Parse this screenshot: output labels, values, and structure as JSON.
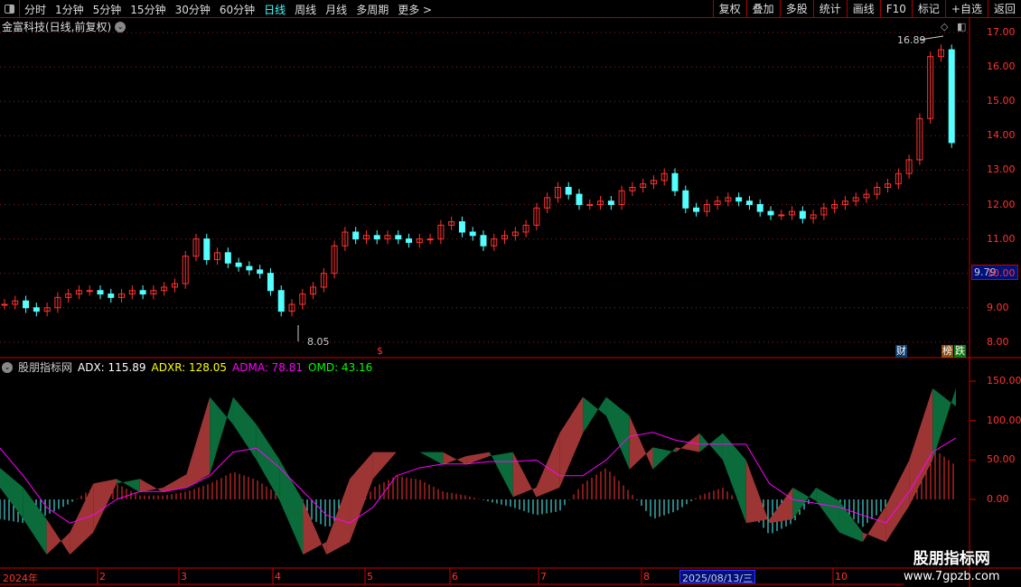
{
  "toolbar": {
    "periods": [
      "分时",
      "1分钟",
      "5分钟",
      "15分钟",
      "30分钟",
      "60分钟",
      "日线",
      "周线",
      "月线",
      "多周期",
      "更多 >"
    ],
    "active": "日线",
    "buttons": [
      "复权",
      "叠加",
      "多股",
      "统计",
      "画线",
      "F10",
      "标记",
      "+自选",
      "返回"
    ]
  },
  "stock": {
    "title": "金富科技(日线,前复权)",
    "current_price_tag": "9.79",
    "high_annotation": "16.89",
    "low_annotation": "8.05",
    "marker_s": "$",
    "tag_cai": "财",
    "tag_bang": "榜",
    "tag_die": "跌"
  },
  "price_axis": [
    "17.00",
    "16.00",
    "15.00",
    "14.00",
    "13.00",
    "12.00",
    "11.00",
    "10.00",
    "9.00",
    "8.00"
  ],
  "indicator": {
    "name": "股朋指标网",
    "adx": "ADX: 115.89",
    "adxr": "ADXR: 128.05",
    "adma": "ADMA: 78.81",
    "omd": "OMD: 43.16",
    "axis": [
      "150.00",
      "100.00",
      "50.00",
      "0.00"
    ]
  },
  "time_axis": {
    "labels": [
      "2024年",
      "2",
      "3",
      "4",
      "5",
      "6",
      "7",
      "8",
      "10"
    ],
    "highlight": "2025/08/13/三"
  },
  "watermark": {
    "title": "股朋指标网",
    "url": "www.7gpzb.com"
  },
  "colors": {
    "up": "#ff3232",
    "down": "#54ffff",
    "adx_up": "#9e3535",
    "adx_down": "#0b6b3a",
    "adma": "#ff00ff",
    "omd_pos": "#ff3232",
    "omd_neg": "#54ffff"
  },
  "chart_data": {
    "type": "candlestick+indicator",
    "price_closes": [
      9.1,
      9.2,
      9.0,
      8.9,
      9.0,
      9.3,
      9.4,
      9.5,
      9.5,
      9.4,
      9.3,
      9.4,
      9.5,
      9.4,
      9.5,
      9.6,
      9.7,
      10.5,
      11.0,
      10.4,
      10.6,
      10.3,
      10.2,
      10.1,
      10.0,
      9.5,
      8.9,
      9.1,
      9.4,
      9.6,
      10.0,
      10.8,
      11.2,
      11.0,
      11.1,
      11.0,
      11.1,
      11.0,
      10.9,
      11.0,
      11.0,
      11.4,
      11.5,
      11.2,
      11.1,
      10.8,
      11.0,
      11.1,
      11.2,
      11.4,
      11.9,
      12.2,
      12.5,
      12.3,
      12.0,
      12.0,
      12.1,
      12.0,
      12.4,
      12.5,
      12.6,
      12.7,
      12.9,
      12.4,
      11.9,
      11.8,
      12.0,
      12.1,
      12.2,
      12.1,
      12.0,
      11.8,
      11.7,
      11.7,
      11.8,
      11.6,
      11.7,
      11.9,
      12.0,
      12.1,
      12.2,
      12.3,
      12.5,
      12.6,
      12.9,
      13.3,
      14.5,
      16.3,
      16.5,
      13.8
    ],
    "price_range": [
      8,
      17
    ],
    "adx": [
      15,
      -25,
      -70,
      -42,
      20,
      26,
      9,
      15,
      32,
      130,
      95,
      50,
      -2,
      -70,
      -54,
      26,
      60,
      60,
      60,
      44,
      55,
      60,
      3,
      15,
      84,
      130,
      106,
      38,
      66,
      60,
      84,
      50,
      -30,
      -25,
      15,
      -2,
      -42,
      -54,
      -8,
      50,
      141,
      118
    ],
    "adxr": [
      40,
      15,
      -25,
      -70,
      -42,
      20,
      26,
      9,
      15,
      32,
      130,
      95,
      50,
      -2,
      -70,
      -54,
      26,
      60,
      60,
      60,
      44,
      55,
      60,
      3,
      15,
      84,
      130,
      106,
      38,
      66,
      60,
      84,
      50,
      -30,
      -25,
      15,
      -2,
      -42,
      -54,
      -8,
      50,
      141
    ],
    "adma": [
      65,
      30,
      -10,
      -30,
      -20,
      0,
      10,
      10,
      15,
      30,
      60,
      65,
      40,
      10,
      -20,
      -30,
      -10,
      30,
      40,
      45,
      45,
      48,
      48,
      50,
      30,
      30,
      50,
      80,
      85,
      75,
      70,
      70,
      70,
      20,
      0,
      -5,
      -10,
      -20,
      -30,
      10,
      60,
      78
    ],
    "omd": [
      -25,
      -30,
      -20,
      -5,
      15,
      20,
      5,
      5,
      10,
      20,
      35,
      25,
      5,
      -20,
      -35,
      -30,
      15,
      30,
      25,
      10,
      5,
      -3,
      -10,
      -20,
      -15,
      20,
      40,
      10,
      -25,
      -15,
      5,
      15,
      -10,
      -45,
      -30,
      5,
      -10,
      -35,
      -10,
      35,
      65,
      43
    ],
    "indicator_range": [
      -85,
      165
    ]
  }
}
